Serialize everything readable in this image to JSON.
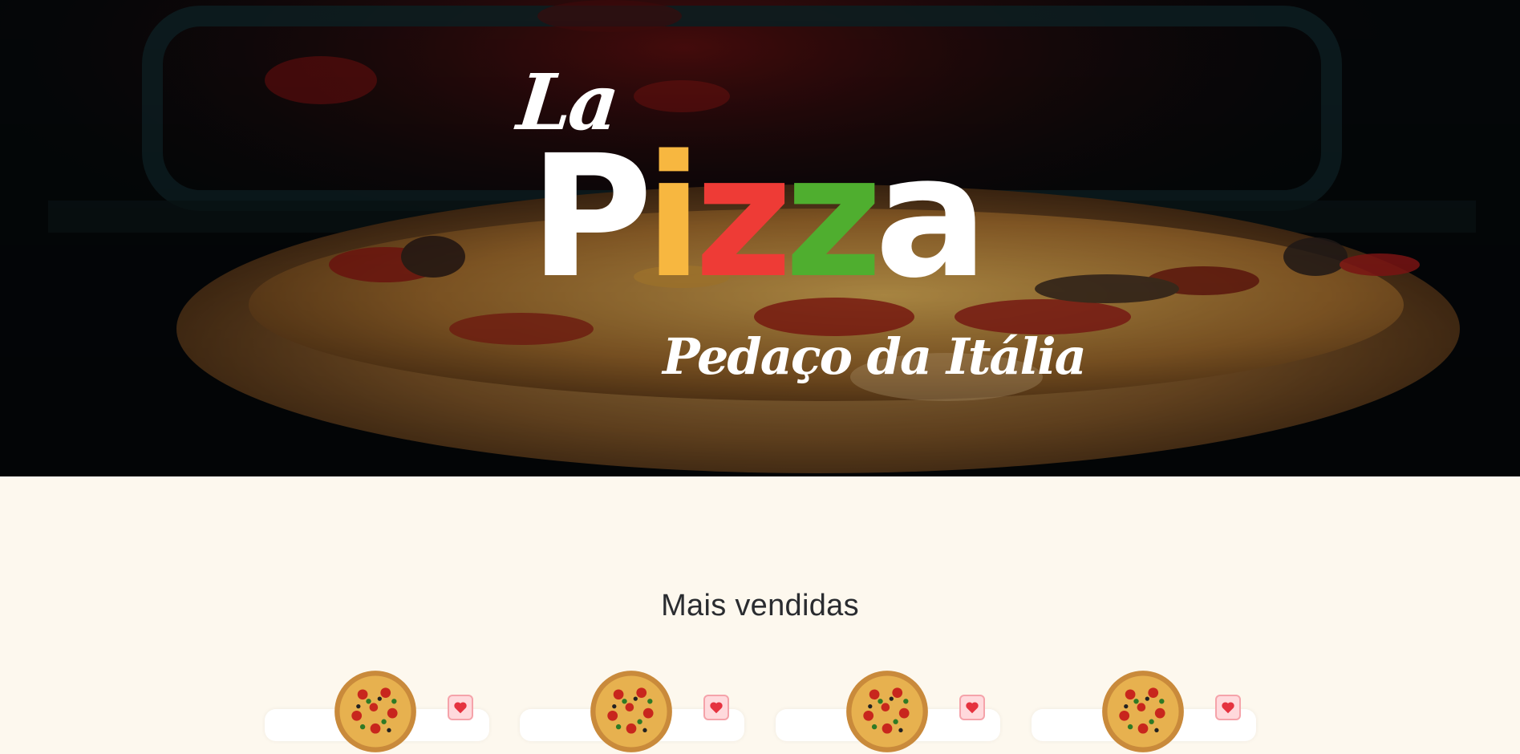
{
  "hero": {
    "logo": {
      "la": "La",
      "letters": [
        {
          "char": "P",
          "color": "#ffffff"
        },
        {
          "char": "i",
          "color": "#f7b740"
        },
        {
          "char": "z",
          "color": "#ee3b36"
        },
        {
          "char": "z",
          "color": "#4fae2f"
        },
        {
          "char": "a",
          "color": "#ffffff"
        }
      ],
      "tagline": "Pedaço da Itália"
    }
  },
  "best_sellers": {
    "title": "Mais vendidas",
    "items": [
      {
        "image": "pizza-icon",
        "favorite_icon": "heart-icon"
      },
      {
        "image": "pizza-icon",
        "favorite_icon": "heart-icon"
      },
      {
        "image": "pizza-icon",
        "favorite_icon": "heart-icon"
      },
      {
        "image": "pizza-icon",
        "favorite_icon": "heart-icon"
      }
    ]
  },
  "colors": {
    "page_background": "#fdf8ee",
    "title_text": "#2a2c30",
    "favorite_bg": "#ffd9dc",
    "favorite_heart": "#e5323f"
  }
}
